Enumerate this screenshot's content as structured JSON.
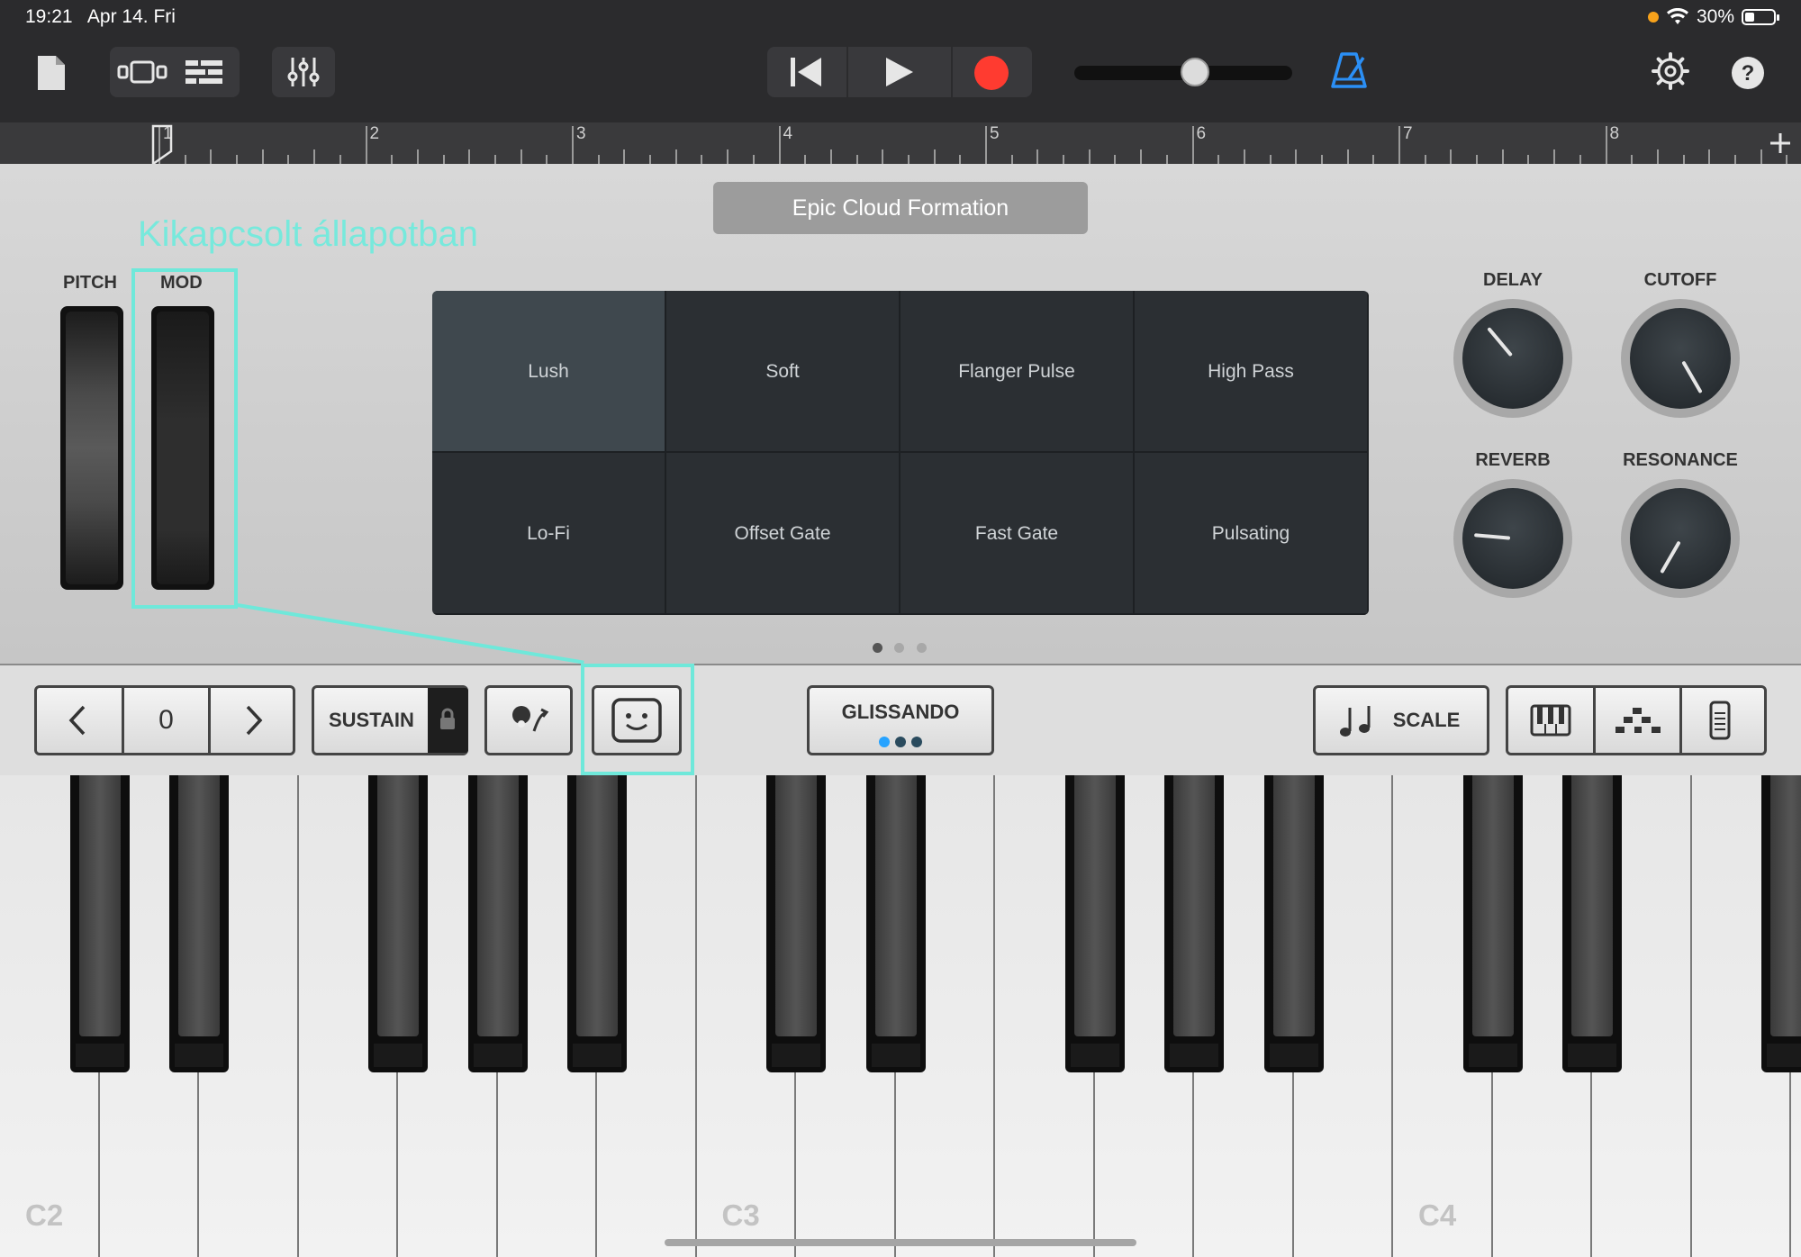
{
  "status_bar": {
    "time": "19:21",
    "date": "Apr 14. Fri",
    "battery": "30%"
  },
  "ruler": {
    "bars": [
      "1",
      "2",
      "3",
      "4",
      "5",
      "6",
      "7",
      "8"
    ]
  },
  "patch_name": "Epic Cloud Formation",
  "annotation": "Kikapcsolt állapotban",
  "wheels": {
    "pitch_label": "PITCH",
    "mod_label": "MOD"
  },
  "pads": [
    {
      "label": "Lush",
      "active": true
    },
    {
      "label": "Soft"
    },
    {
      "label": "Flanger Pulse"
    },
    {
      "label": "High Pass"
    },
    {
      "label": "Lo-Fi"
    },
    {
      "label": "Offset Gate"
    },
    {
      "label": "Fast Gate"
    },
    {
      "label": "Pulsating"
    }
  ],
  "pages": {
    "count": 3,
    "current": 1
  },
  "knobs": [
    {
      "label": "DELAY",
      "angle_deg": -40
    },
    {
      "label": "CUTOFF",
      "angle_deg": 150
    },
    {
      "label": "REVERB",
      "angle_deg": -85
    },
    {
      "label": "RESONANCE",
      "angle_deg": -150
    }
  ],
  "controls": {
    "octave_value": "0",
    "sustain_label": "SUSTAIN",
    "glissando_label": "GLISSANDO",
    "scale_label": "SCALE"
  },
  "keyboard": {
    "notes": [
      "C2",
      "C3",
      "C4"
    ]
  },
  "colors": {
    "accent_cyan": "#6fe8da",
    "record_red": "#ff3b30",
    "metronome_blue": "#2b8ff5"
  }
}
